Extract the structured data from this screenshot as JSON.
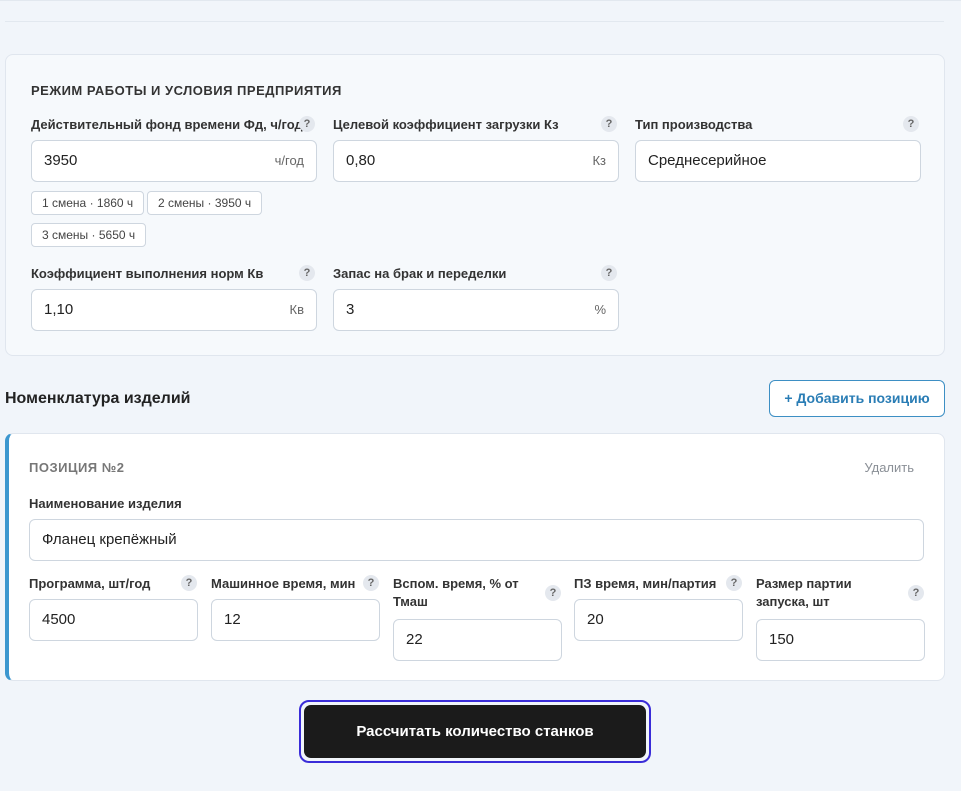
{
  "enterprise": {
    "section_title": "РЕЖИМ РАБОТЫ И УСЛОВИЯ ПРЕДПРИЯТИЯ",
    "help_glyph": "?",
    "time_fund": {
      "label": "Действительный фонд времени Фд, ч/год",
      "value": "3950",
      "unit": "ч/год"
    },
    "load_coef": {
      "label": "Целевой коэффициент загрузки Кз",
      "value": "0,80",
      "unit": "Кз"
    },
    "production_type": {
      "label": "Тип производства",
      "value": "Среднесерийное"
    },
    "shift_presets": [
      "1 смена · 1860 ч",
      "2 смены · 3950 ч",
      "3 смены · 5650 ч"
    ],
    "norm_coef": {
      "label": "Коэффициент выполнения норм Кв",
      "value": "1,10",
      "unit": "Кв"
    },
    "defect_reserve": {
      "label": "Запас на брак и переделки",
      "value": "3",
      "unit": "%"
    }
  },
  "nomenclature": {
    "title": "Номенклатура изделий",
    "add_label": "+ Добавить позицию"
  },
  "position": {
    "title": "ПОЗИЦИЯ №2",
    "delete_label": "Удалить",
    "name": {
      "label": "Наименование изделия",
      "value": "Фланец крепёжный"
    },
    "program": {
      "label": "Программа, шт/год",
      "value": "4500"
    },
    "machine_time": {
      "label": "Машинное время, мин",
      "value": "12"
    },
    "aux_time": {
      "label": "Вспом. время, % от Тмаш",
      "value": "22"
    },
    "pz_time": {
      "label": "ПЗ время, мин/партия",
      "value": "20"
    },
    "batch_size": {
      "label": "Размер партии запуска, шт",
      "value": "150"
    }
  },
  "calculate_label": "Рассчитать количество станков"
}
